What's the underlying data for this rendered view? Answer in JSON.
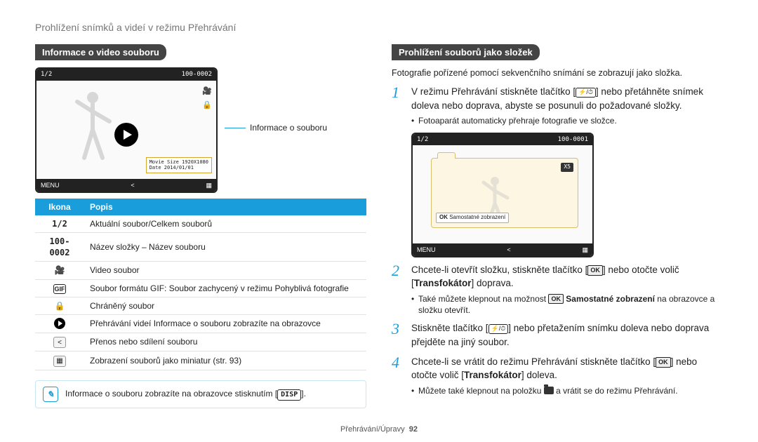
{
  "page_title": "Prohlížení snímků a videí v režimu Přehrávání",
  "left": {
    "section_title": "Informace o video souboru",
    "preview": {
      "top_left": "1/2",
      "top_right": "100-0002",
      "info_box_l1": "Movie Size   1920X1080",
      "info_box_l2": "Date         2014/01/01",
      "bottom_left": "MENU"
    },
    "leader_label": "Informace o souboru",
    "th_icon": "Ikona",
    "th_desc": "Popis",
    "rows": {
      "r0": {
        "icon": "1/2",
        "desc": "Aktuální soubor/Celkem souborů"
      },
      "r1": {
        "icon": "100-0002",
        "desc": "Název složky – Název souboru"
      },
      "r2": {
        "desc": "Video soubor"
      },
      "r3": {
        "icon": "GIF",
        "desc": "Soubor formátu GIF: Soubor zachycený v režimu Pohyblivá fotografie"
      },
      "r4": {
        "desc": "Chráněný soubor"
      },
      "r5": {
        "desc": "Přehrávání videí Informace o souboru zobrazíte na obrazovce"
      },
      "r6": {
        "desc": "Přenos nebo sdílení souboru"
      },
      "r7": {
        "desc": "Zobrazení souborů jako miniatur (str. 93)"
      }
    },
    "note_before": "Informace o souboru zobrazíte na obrazovce stisknutím [",
    "note_chip": "DISP",
    "note_after": "]."
  },
  "right": {
    "section_title": "Prohlížení souborů jako složek",
    "intro": "Fotografie pořízené pomocí sekvenčního snímání se zobrazují jako složka.",
    "steps": {
      "s1": {
        "n": "1",
        "t1": "V režimu Přehrávání stiskněte tlačítko [",
        "t2": "] nebo přetáhněte snímek doleva nebo doprava, abyste se posunuli do požadované složky.",
        "sub1": "Fotoaparát automaticky přehraje fotografie ve složce."
      },
      "preview2": {
        "top_left": "1/2",
        "top_right": "100-0001",
        "badge": "X5",
        "ok_prefix": "OK",
        "ok_label": " Samostatné zobrazení",
        "bottom_left": "MENU"
      },
      "s2": {
        "n": "2",
        "t1": "Chcete-li otevřít složku, stiskněte tlačítko [",
        "ok": "OK",
        "t2": "] nebo otočte volič [",
        "bold": "Transfokátor",
        "t3": "] doprava.",
        "sub_a": "Také můžete klepnout na možnost ",
        "sub_ok_inline": "OK",
        "sub_bold": " Samostatné zobrazení",
        "sub_b": " na obrazovce a složku otevřít."
      },
      "s3": {
        "n": "3",
        "t1": "Stiskněte tlačítko [",
        "t2": "] nebo přetažením snímku doleva nebo doprava přejděte na jiný soubor."
      },
      "s4": {
        "n": "4",
        "t1": "Chcete-li se vrátit do režimu Přehrávání stiskněte tlačítko [",
        "ok": "OK",
        "t2": "] nebo otočte volič [",
        "bold": "Transfokátor",
        "t3": "] doleva.",
        "sub_a": "Můžete také klepnout na položku ",
        "sub_b": " a vrátit se do režimu Přehrávání."
      }
    }
  },
  "footer": {
    "section": "Přehrávání/Úpravy",
    "page": "92"
  }
}
